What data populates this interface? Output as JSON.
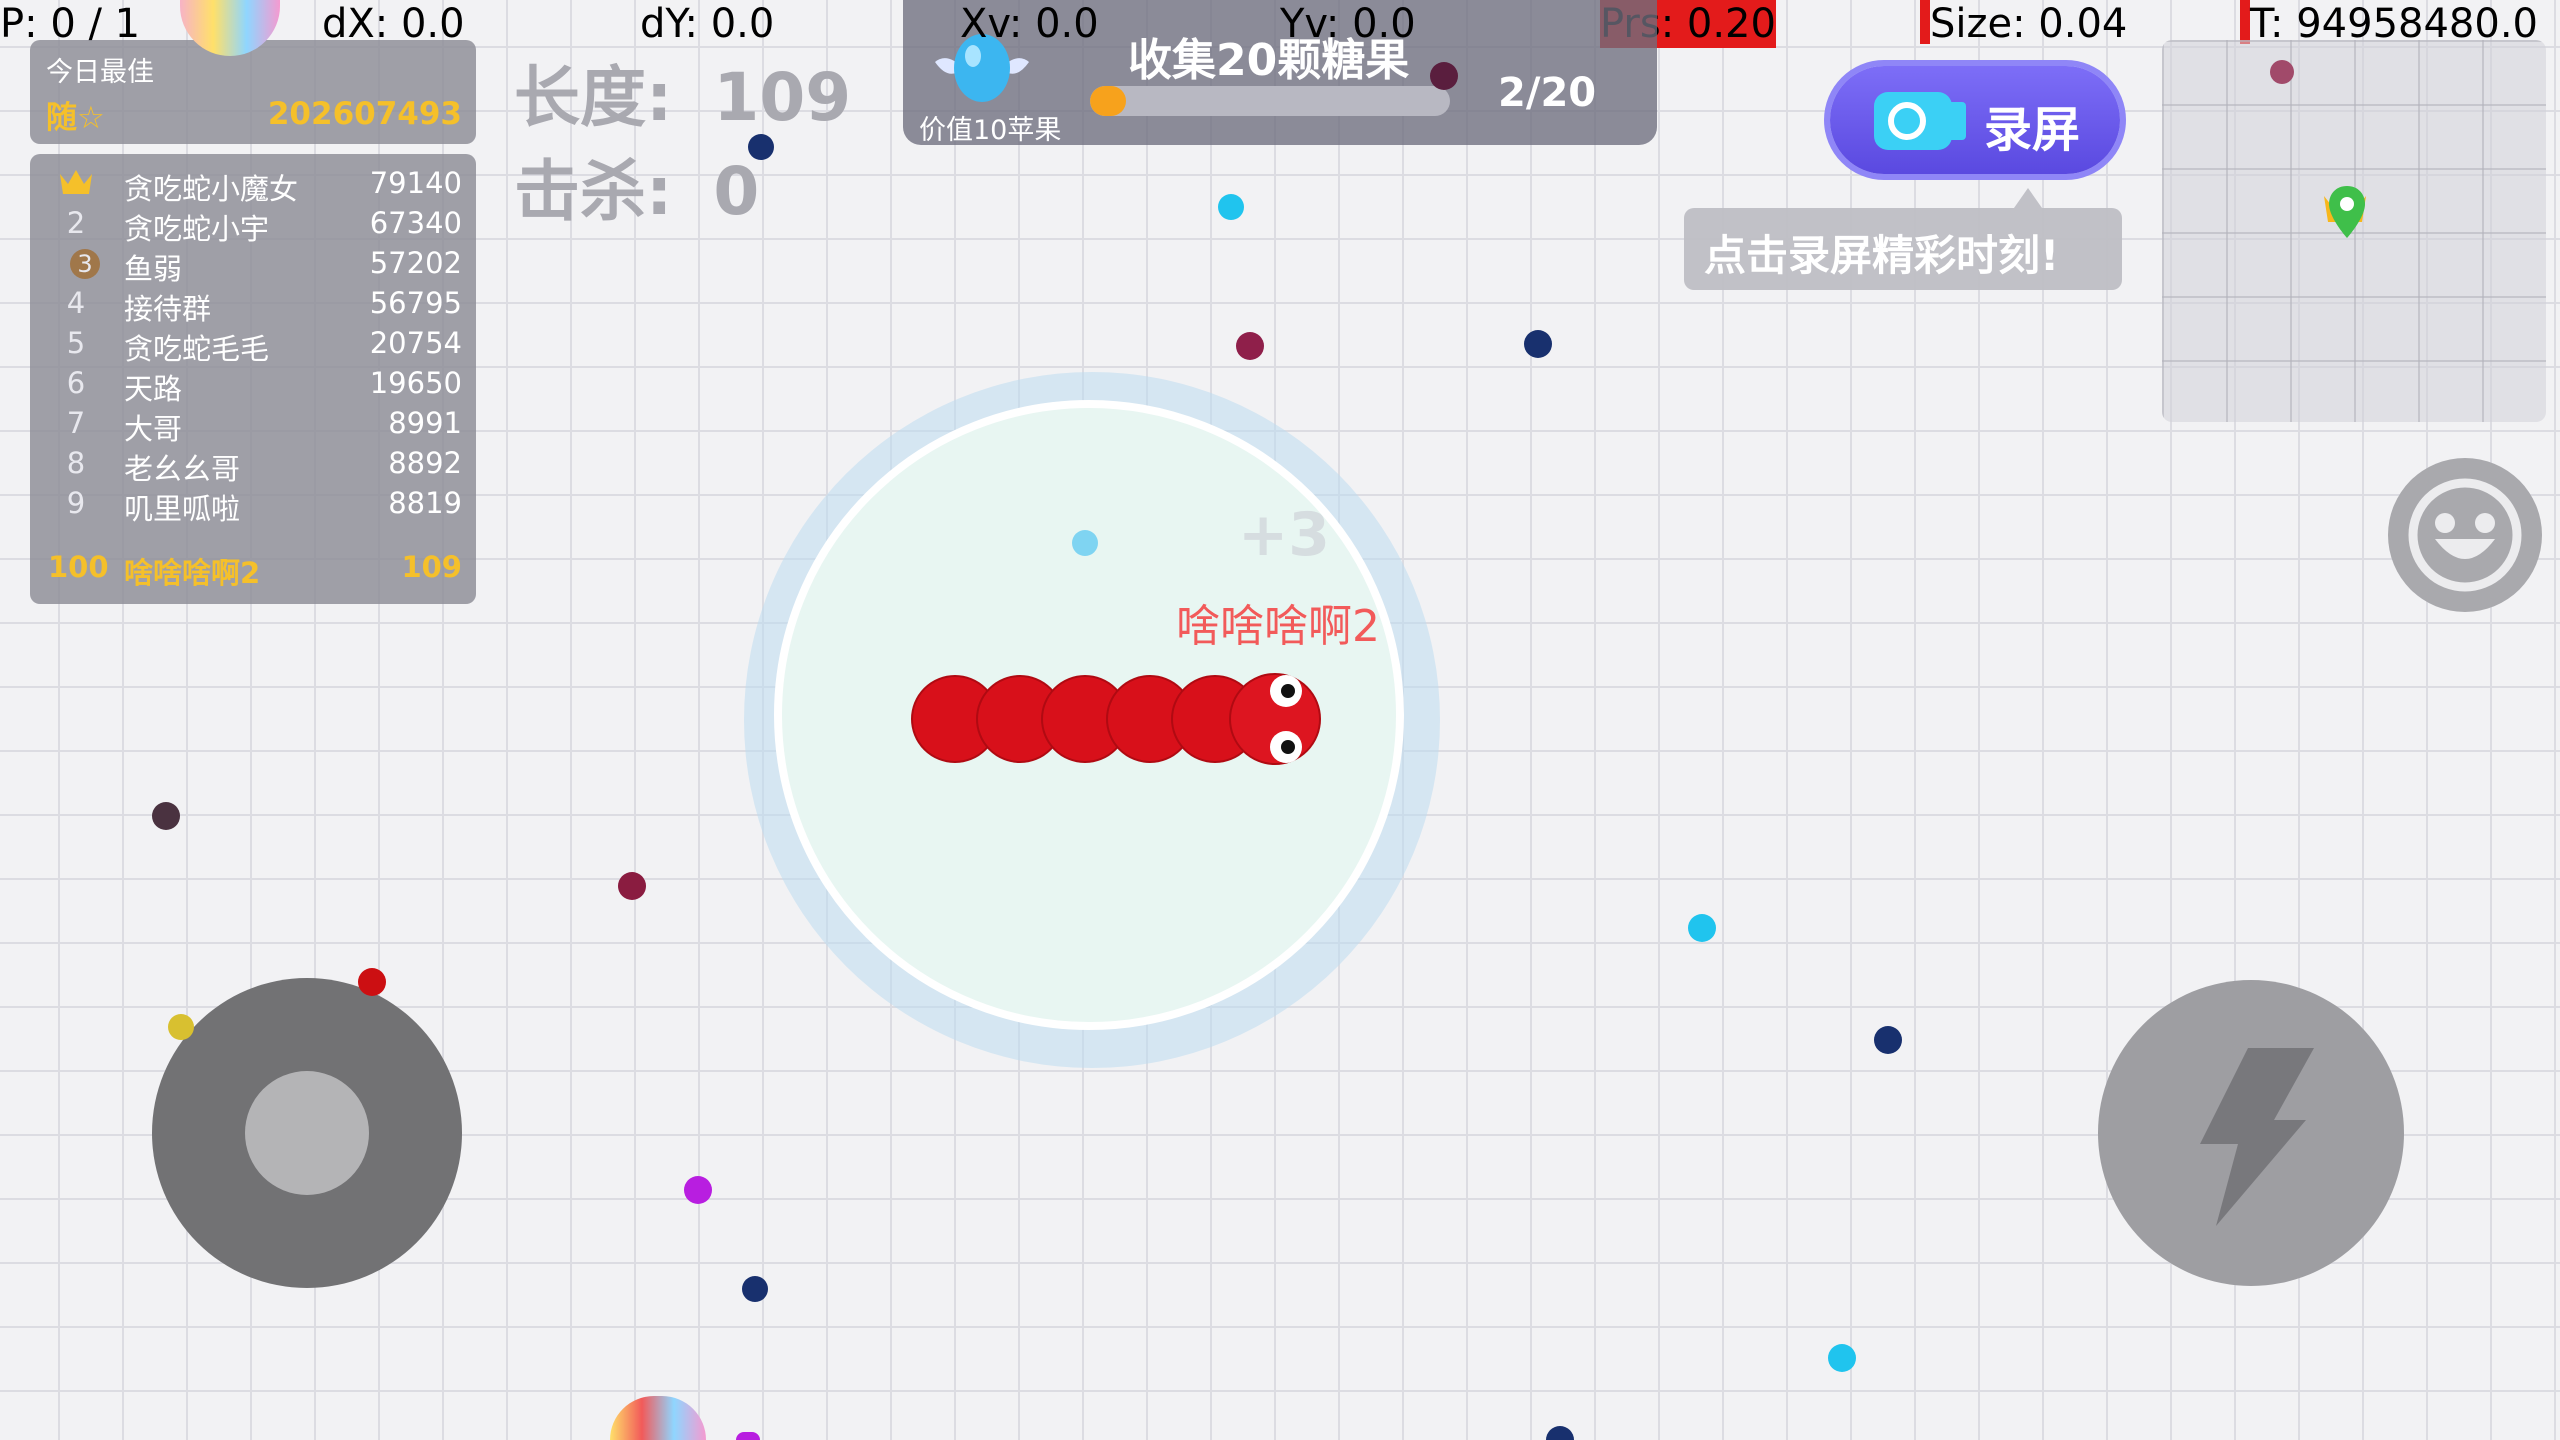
{
  "debug": {
    "p": "P: 0 / 1",
    "dx": "dX: 0.0",
    "dy": "dY: 0.0",
    "xv": "Xv: 0.0",
    "yv": "Yv: 0.0",
    "prs": "Prs: 0.20",
    "size": "Size: 0.04",
    "t": "T: 94958480.0"
  },
  "leaderboard": {
    "best_title": "今日最佳",
    "best_name": "随☆",
    "best_score": "202607493",
    "rows": [
      {
        "rank": "",
        "name": "贪吃蛇小魔女",
        "score": "79140"
      },
      {
        "rank": "2",
        "name": "贪吃蛇小宇",
        "score": "67340"
      },
      {
        "rank": "3",
        "name": "鱼弱",
        "score": "57202"
      },
      {
        "rank": "4",
        "name": "接待群",
        "score": "56795"
      },
      {
        "rank": "5",
        "name": "贪吃蛇毛毛",
        "score": "20754"
      },
      {
        "rank": "6",
        "name": "天路",
        "score": "19650"
      },
      {
        "rank": "7",
        "name": "大哥",
        "score": "8991"
      },
      {
        "rank": "8",
        "name": "老幺幺哥",
        "score": "8892"
      },
      {
        "rank": "9",
        "name": "叽里呱啦",
        "score": "8819"
      }
    ],
    "me": {
      "rank": "100",
      "name": "啥啥啥啊2",
      "score": "109"
    }
  },
  "stats": {
    "length_label": "长度:",
    "length_value": "109",
    "kills_label": "击杀:",
    "kills_value": "0"
  },
  "mission": {
    "title": "收集20颗糖果",
    "reward": "价值10苹果",
    "progress_text": "2/20",
    "progress": 0.1
  },
  "record": {
    "button_label": "录屏",
    "tip": "点击录屏精彩时刻!"
  },
  "player": {
    "name": "啥啥啥啊2",
    "bonus": "+3"
  },
  "icons": {
    "crown": "crown-icon",
    "lightning": "lightning-icon",
    "emoji": "smiley-icon",
    "camera": "camera-icon",
    "map_pin": "map-pin-icon"
  },
  "colors": {
    "snake": "#d8101a",
    "progress": "#f7a21c",
    "record_button": "#6a5af0",
    "gold": "#f5c02a"
  }
}
